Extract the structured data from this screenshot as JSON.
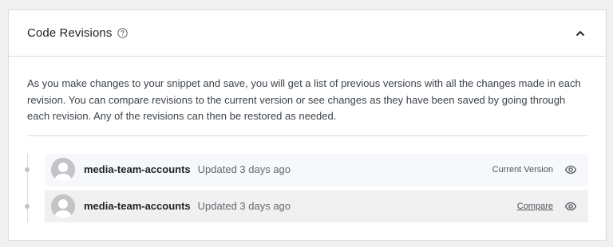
{
  "panel": {
    "title": "Code Revisions",
    "help_icon": "question-circle-icon",
    "collapse_icon": "chevron-up-icon",
    "description": "As you make changes to your snippet and save, you will get a list of previous versions with all the changes made in each revision. You can compare revisions to the current version or see changes as they have been saved by going through each revision. Any of the revisions can then be restored as needed."
  },
  "revisions": [
    {
      "name": "media-team-accounts",
      "updated": "Updated 3 days ago",
      "status": "Current Version",
      "action_icon": "eye-icon"
    },
    {
      "name": "media-team-accounts",
      "updated": "Updated 3 days ago",
      "link": "Compare",
      "action_icon": "eye-icon"
    }
  ],
  "colors": {
    "border": "#dcdcde",
    "current_row_bg": "#f6f8fb",
    "past_row_bg": "#f0f0f1",
    "avatar": "#c3c4c7"
  }
}
